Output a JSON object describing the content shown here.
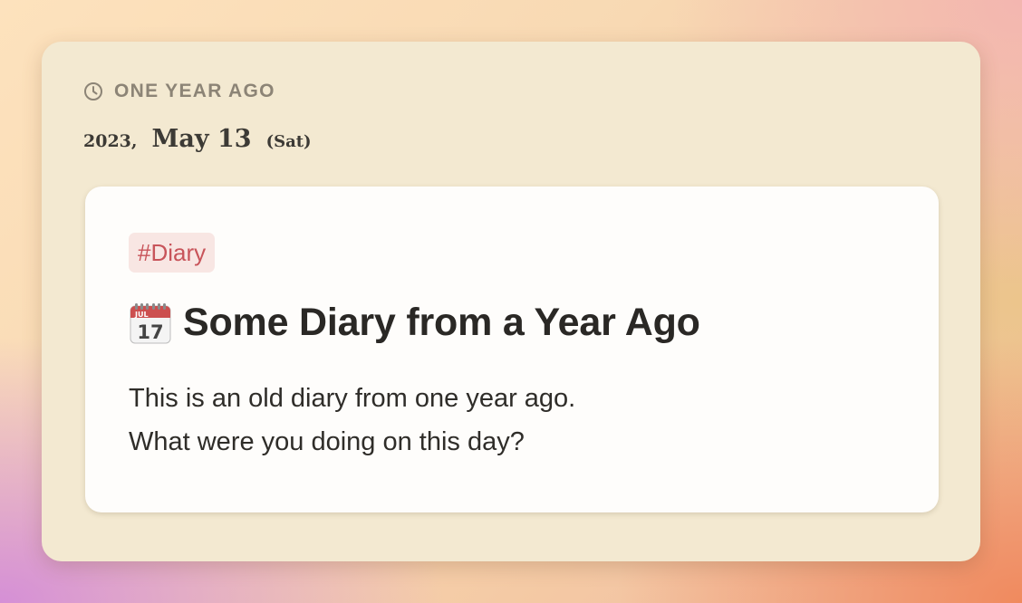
{
  "memory_card": {
    "header_label": "ONE YEAR AGO",
    "header_icon": "clock-icon",
    "date": {
      "year": "2023",
      "comma": ",",
      "month_day": "May 13",
      "weekday": "(Sat)"
    },
    "note": {
      "tag": "#Diary",
      "title_icon": "calendar-icon",
      "title_icon_month": "JUL",
      "title_icon_day": "17",
      "title": "Some Diary from a Year Ago",
      "body_lines": [
        "This is an old diary from one year ago.",
        "What were you doing on this day?"
      ]
    }
  },
  "colors": {
    "outer_card_bg": "#f3e9d1",
    "inner_card_bg": "#fefdfb",
    "tag_bg": "#f8e6e3",
    "tag_text": "#c8545a",
    "header_text": "#8c8476",
    "title_text": "#2a2825"
  }
}
